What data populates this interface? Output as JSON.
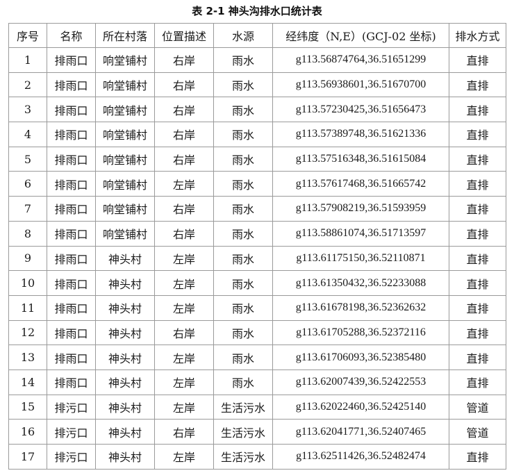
{
  "caption": "表 2-1 神头沟排水口统计表",
  "headers": {
    "seq": "序号",
    "name": "名称",
    "village": "所在村落",
    "position": "位置描述",
    "source": "水源",
    "coord": "经纬度（N,E）(GCJ-02 坐标)",
    "method": "排水方式"
  },
  "rows": [
    {
      "seq": "1",
      "name": "排雨口",
      "village": "响堂铺村",
      "position": "右岸",
      "source": "雨水",
      "coord": "g113.56874764,36.51651299",
      "method": "直排"
    },
    {
      "seq": "2",
      "name": "排雨口",
      "village": "响堂铺村",
      "position": "右岸",
      "source": "雨水",
      "coord": "g113.56938601,36.51670700",
      "method": "直排"
    },
    {
      "seq": "3",
      "name": "排雨口",
      "village": "响堂铺村",
      "position": "右岸",
      "source": "雨水",
      "coord": "g113.57230425,36.51656473",
      "method": "直排"
    },
    {
      "seq": "4",
      "name": "排雨口",
      "village": "响堂铺村",
      "position": "右岸",
      "source": "雨水",
      "coord": "g113.57389748,36.51621336",
      "method": "直排"
    },
    {
      "seq": "5",
      "name": "排雨口",
      "village": "响堂铺村",
      "position": "右岸",
      "source": "雨水",
      "coord": "g113.57516348,36.51615084",
      "method": "直排"
    },
    {
      "seq": "6",
      "name": "排雨口",
      "village": "响堂铺村",
      "position": "左岸",
      "source": "雨水",
      "coord": "g113.57617468,36.51665742",
      "method": "直排"
    },
    {
      "seq": "7",
      "name": "排雨口",
      "village": "响堂铺村",
      "position": "右岸",
      "source": "雨水",
      "coord": "g113.57908219,36.51593959",
      "method": "直排"
    },
    {
      "seq": "8",
      "name": "排雨口",
      "village": "响堂铺村",
      "position": "右岸",
      "source": "雨水",
      "coord": "g113.58861074,36.51713597",
      "method": "直排"
    },
    {
      "seq": "9",
      "name": "排雨口",
      "village": "神头村",
      "position": "左岸",
      "source": "雨水",
      "coord": "g113.61175150,36.52110871",
      "method": "直排"
    },
    {
      "seq": "10",
      "name": "排雨口",
      "village": "神头村",
      "position": "左岸",
      "source": "雨水",
      "coord": "g113.61350432,36.52233088",
      "method": "直排"
    },
    {
      "seq": "11",
      "name": "排雨口",
      "village": "神头村",
      "position": "左岸",
      "source": "雨水",
      "coord": "g113.61678198,36.52362632",
      "method": "直排"
    },
    {
      "seq": "12",
      "name": "排雨口",
      "village": "神头村",
      "position": "右岸",
      "source": "雨水",
      "coord": "g113.61705288,36.52372116",
      "method": "直排"
    },
    {
      "seq": "13",
      "name": "排雨口",
      "village": "神头村",
      "position": "左岸",
      "source": "雨水",
      "coord": "g113.61706093,36.52385480",
      "method": "直排"
    },
    {
      "seq": "14",
      "name": "排雨口",
      "village": "神头村",
      "position": "左岸",
      "source": "雨水",
      "coord": "g113.62007439,36.52422553",
      "method": "直排"
    },
    {
      "seq": "15",
      "name": "排污口",
      "village": "神头村",
      "position": "左岸",
      "source": "生活污水",
      "coord": "g113.62022460,36.52425140",
      "method": "管道"
    },
    {
      "seq": "16",
      "name": "排污口",
      "village": "神头村",
      "position": "右岸",
      "source": "生活污水",
      "coord": "g113.62041771,36.52407465",
      "method": "管道"
    },
    {
      "seq": "17",
      "name": "排污口",
      "village": "神头村",
      "position": "左岸",
      "source": "生活污水",
      "coord": "g113.62511426,36.52482474",
      "method": "直排"
    }
  ]
}
